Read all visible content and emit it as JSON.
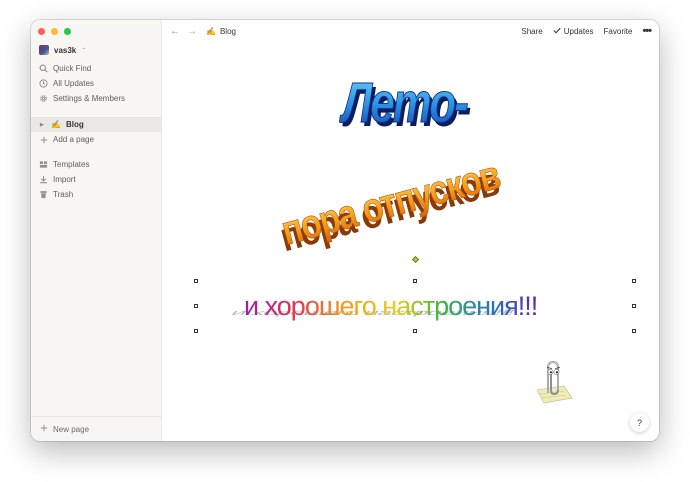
{
  "window": {
    "title": "Blog"
  },
  "sidebar": {
    "workspace": "vas3k",
    "nav": [
      {
        "label": "Quick Find",
        "icon": "search-icon"
      },
      {
        "label": "All Updates",
        "icon": "clock-icon"
      },
      {
        "label": "Settings & Members",
        "icon": "gear-icon"
      }
    ],
    "page": {
      "emoji": "✍️",
      "label": "Blog"
    },
    "add_page": "Add a page",
    "tools": [
      {
        "label": "Templates",
        "icon": "templates-icon"
      },
      {
        "label": "Import",
        "icon": "import-icon"
      },
      {
        "label": "Trash",
        "icon": "trash-icon"
      }
    ],
    "new_page": "New page"
  },
  "topbar": {
    "breadcrumb_emoji": "✍️",
    "breadcrumb": "Blog",
    "share": "Share",
    "updates": "Updates",
    "favorite": "Favorite",
    "more": "•••"
  },
  "wordart": {
    "line1": "Лето-",
    "line2": "пора отпусков",
    "line3": "и хорошего настроения!!!"
  },
  "help": "?"
}
